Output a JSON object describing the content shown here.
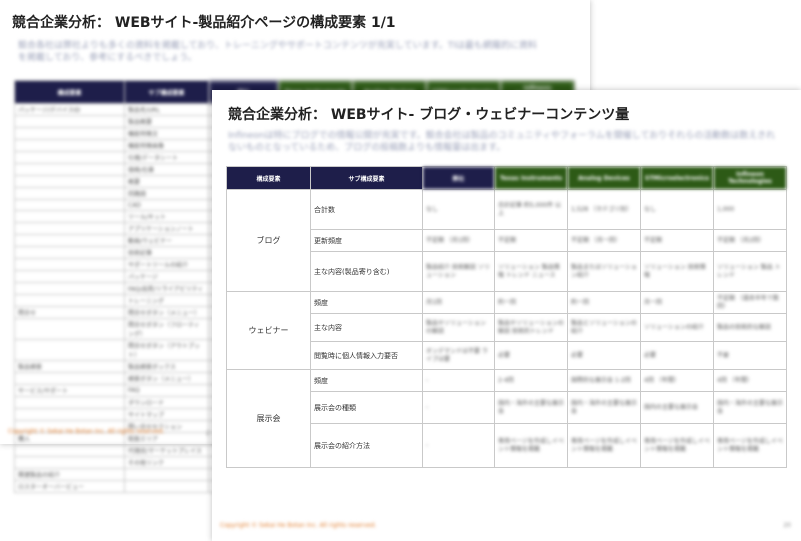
{
  "back_slide": {
    "title": "競合企業分析： WEBサイト-製品紹介ページの構成要素 1/1",
    "description": "競合各社は弊社よりも多くの資料を掲載しており、トレーニングやサポートコンテンツが充実しています。TIは最も網羅的に資料を掲載しており、参考にするべきでしょう。",
    "headers": [
      "構成要素",
      "サブ構成要素",
      "弊社",
      "Texas Instruments",
      "Analog Devices",
      "STMicroelectronics",
      "Infineon Technologies"
    ],
    "rows": [
      {
        "group": "パッケージ/デバイスID",
        "sub": "製品名/URL"
      },
      {
        "group": "",
        "sub": "製品概要"
      },
      {
        "group": "",
        "sub": "機能特徴文"
      },
      {
        "group": "",
        "sub": "機能特徴画像"
      },
      {
        "group": "",
        "sub": "仕様/データシート"
      },
      {
        "group": "",
        "sub": "価格/在庫"
      },
      {
        "group": "",
        "sub": "概要"
      },
      {
        "group": "",
        "sub": "回路図"
      },
      {
        "group": "",
        "sub": "CAD"
      },
      {
        "group": "",
        "sub": "ツール/キット"
      },
      {
        "group": "",
        "sub": "アプリケーションノート"
      },
      {
        "group": "",
        "sub": "動画/ウェビナー"
      },
      {
        "group": "",
        "sub": "技術記事"
      },
      {
        "group": "",
        "sub": "サポートツールの紹介"
      },
      {
        "group": "",
        "sub": "パッケージ"
      },
      {
        "group": "",
        "sub": "FAQ/品質/リライアビリティ"
      },
      {
        "group": "",
        "sub": "トレーニング"
      },
      {
        "group": "問合せ",
        "sub": "問合せボタン（メニュー）"
      },
      {
        "group": "",
        "sub": "問合せボタン（フローティング）"
      },
      {
        "group": "",
        "sub": "問合せボタン（アウトプット）"
      },
      {
        "group": "製品検索",
        "sub": "製品検索ボックス"
      },
      {
        "group": "",
        "sub": "検索ボタン（メニュー）"
      },
      {
        "group": "サービス/サポート",
        "sub": "FAQ"
      },
      {
        "group": "",
        "sub": "ダウンロード"
      },
      {
        "group": "",
        "sub": "サイトマップ"
      },
      {
        "group": "",
        "sub": "問い合せセクション"
      },
      {
        "group": "購入",
        "sub": "取扱エリア"
      },
      {
        "group": "",
        "sub": "代理店/マーケットプレイス"
      },
      {
        "group": "",
        "sub": "その他リンク"
      },
      {
        "group": "関連製品の紹介",
        "sub": ""
      },
      {
        "group": "ロスターオーバービュー",
        "sub": ""
      }
    ],
    "footer": "Copyright © Sekai He Botan Inc. All rights reserved.",
    "page": "2"
  },
  "front_slide": {
    "title": "競合企業分析： WEBサイト- ブログ・ウェビナーコンテンツ量",
    "description": "Infineonは特にブログでの情報公開が充実です。競合会社は製品のコミュニティやフォーラムを開催しておりそれらの活動数は数えきれないものとなっているため、ブログの投稿数よりも情報量は出ます。",
    "headers": [
      "構成要素",
      "サブ構成要素",
      "弊社",
      "Texas Instruments",
      "Analog Devices",
      "STMicroelectronics",
      "Infineon Technologies"
    ],
    "groups": [
      {
        "name": "ブログ",
        "rows": [
          {
            "sub": "合計数",
            "cells": [
              "なし",
              "合計記事 約5,000件 以上",
              "1,528 （カテゴリ別）",
              "なし",
              "1,000"
            ]
          },
          {
            "sub": "更新頻度",
            "cells": [
              "不定期 （月1回）",
              "不定期",
              "不定期 （月一回）",
              "不定期",
              "不定期 （月2回）"
            ]
          },
          {
            "sub": "主な内容(製品寄り含む)",
            "cells": [
              "製品紹介 技術解説 ソリューション",
              "ソリューション 製品情報 トレンド ニュース",
              "製品またはソリューション紹介",
              "ソリューション 技術情報",
              "ソリューション 製品 トレンド"
            ]
          }
        ]
      },
      {
        "name": "ウェビナー",
        "rows": [
          {
            "sub": "頻度",
            "cells": [
              "月1回",
              "約一回",
              "約一回",
              "月一回",
              "不定期 （過去半年で数回）"
            ]
          },
          {
            "sub": "主な内容",
            "cells": [
              "製品やソリューションの解説",
              "製品やソリューションの解説 技術的トレンド",
              "製品とソリューションの紹介",
              "ソリューションの紹介",
              "製品の技術的な解説"
            ]
          },
          {
            "sub": "閲覧時に個人情報入力要否",
            "cells": [
              "オンデマンドは不要 ライブは要",
              "必要",
              "必要",
              "必要",
              "不要"
            ]
          }
        ]
      },
      {
        "name": "展示会",
        "rows": [
          {
            "sub": "頻度",
            "cells": [
              "-",
              "2-4回",
              "国際的な展示会 1-2回",
              "4回 （年間）",
              "4回 （年間）"
            ]
          },
          {
            "sub": "展示会の種類",
            "cells": [
              "-",
              "国内・海外の主要な展示会",
              "国内・海外の主要な展示会",
              "国内の主要な展示会",
              "国内・海外の主要な展示会"
            ]
          },
          {
            "sub": "展示会の紹介方法",
            "cells": [
              "-",
              "専用ページを作成しイベント情報を掲載",
              "専用ページを作成しイベント情報を掲載",
              "専用ページを作成しイベント情報を掲載",
              "専用ページを作成しイベント情報を掲載"
            ]
          }
        ]
      }
    ],
    "footer": "Copyright © Sekai He Botan Inc. All rights reserved.",
    "page": "20"
  }
}
